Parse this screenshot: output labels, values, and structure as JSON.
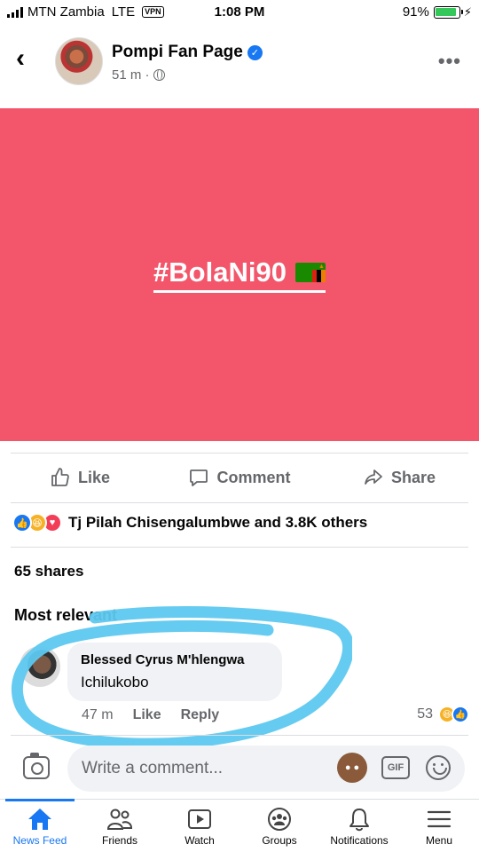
{
  "status_bar": {
    "carrier": "MTN Zambia",
    "network": "LTE",
    "vpn": "VPN",
    "time": "1:08 PM",
    "battery": "91%",
    "battery_level": 0.91
  },
  "post": {
    "page_name": "Pompi Fan Page",
    "time_ago": "51 m ·",
    "hashtag": "#BolaNi90",
    "actions": {
      "like": "Like",
      "comment": "Comment",
      "share": "Share"
    },
    "reactions_text": "Tj Pilah Chisengalumbwe and 3.8K others",
    "shares": "65 shares",
    "sort_label": "Most relevant"
  },
  "comment": {
    "author": "Blessed Cyrus M'hlengwa",
    "text": "Ichilukobo",
    "time": "47 m",
    "like": "Like",
    "reply": "Reply",
    "reaction_count": "53"
  },
  "composer": {
    "placeholder": "Write a comment...",
    "gif": "GIF"
  },
  "tabs": [
    {
      "label": "News Feed",
      "icon": "home-icon",
      "active": true
    },
    {
      "label": "Friends",
      "icon": "friends-icon"
    },
    {
      "label": "Watch",
      "icon": "watch-icon"
    },
    {
      "label": "Groups",
      "icon": "groups-icon"
    },
    {
      "label": "Notifications",
      "icon": "bell-icon"
    },
    {
      "label": "Menu",
      "icon": "menu-icon"
    }
  ],
  "colors": {
    "brand": "#1877f2",
    "post_background": "#f3566a",
    "highlight": "#5ec8ef"
  }
}
